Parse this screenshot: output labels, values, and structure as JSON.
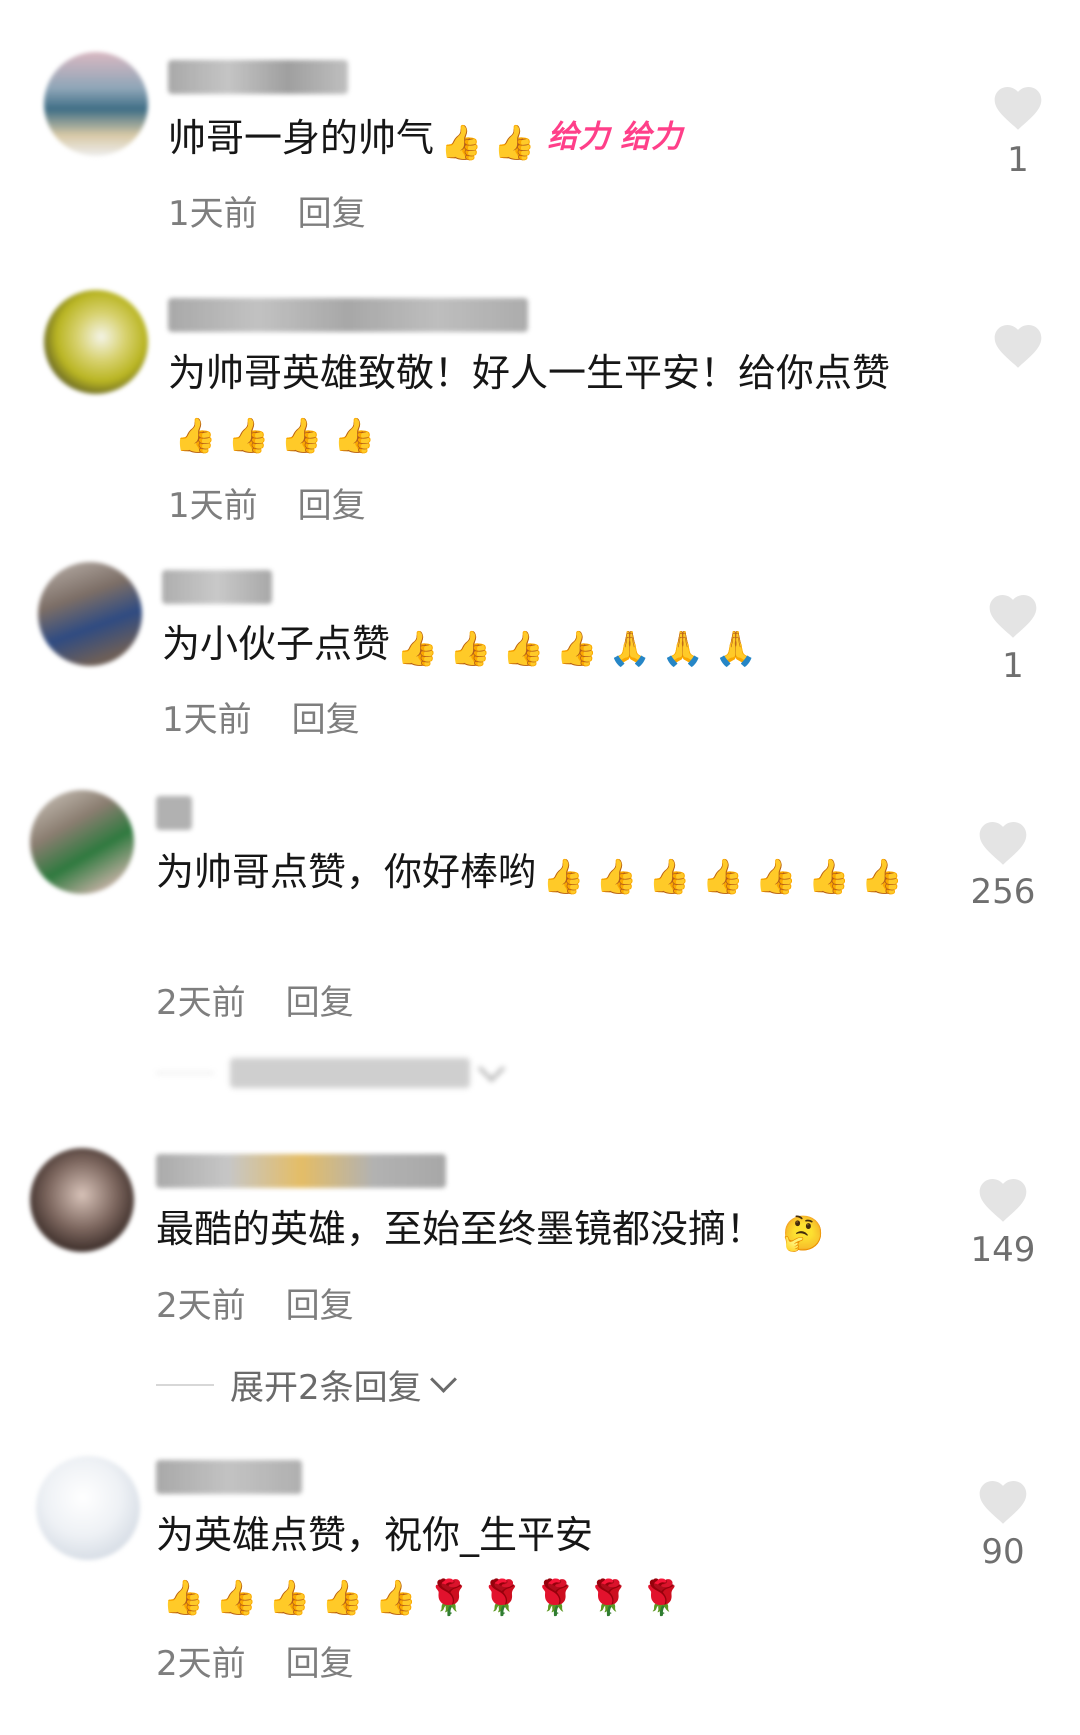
{
  "comments": [
    {
      "text": "帅哥一身的帅气",
      "emojis": "👍 👍",
      "sticker": "给力 给力",
      "time": "1天前",
      "reply": "回复",
      "likes": "1"
    },
    {
      "text": "为帅哥英雄致敬！好人一生平安！给你点赞",
      "emojis": "👍 👍 👍 👍",
      "time": "1天前",
      "reply": "回复",
      "likes": ""
    },
    {
      "text": "为小伙子点赞",
      "emojis": "👍 👍 👍 👍 🙏 🙏 🙏",
      "time": "1天前",
      "reply": "回复",
      "likes": "1"
    },
    {
      "text": "为帅哥点赞，你好棒哟",
      "emojis": "👍 👍 👍 👍 👍 👍 👍",
      "time": "2天前",
      "reply": "回复",
      "likes": "256"
    },
    {
      "text": "最酷的英雄，至始至终墨镜都没摘！",
      "emojis": "🤔",
      "time": "2天前",
      "reply": "回复",
      "likes": "149",
      "expand": "展开2条回复"
    },
    {
      "text": "为英雄点赞，祝你_生平安",
      "emojis": "👍 👍 👍 👍 👍 🌹 🌹 🌹 🌹 🌹",
      "time": "2天前",
      "reply": "回复",
      "likes": "90"
    }
  ],
  "colors": {
    "heart": "#e4e4e4",
    "meta_text": "#7e7e7e",
    "sticker": "#ff3f89"
  }
}
